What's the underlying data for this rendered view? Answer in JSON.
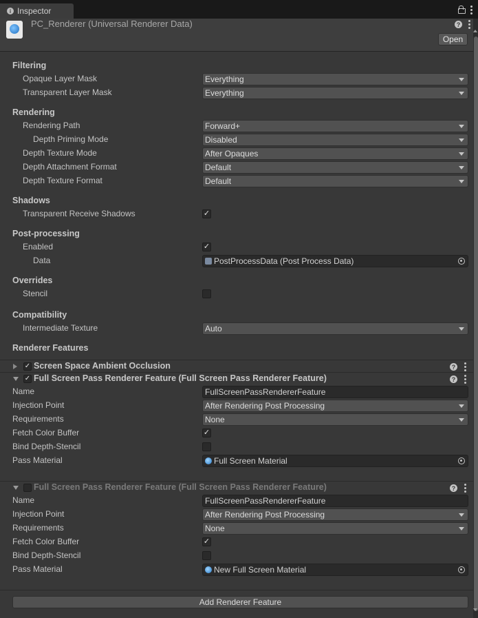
{
  "tab": {
    "label": "Inspector"
  },
  "header": {
    "title": "PC_Renderer (Universal Renderer Data)",
    "open_label": "Open"
  },
  "sections": {
    "filtering": "Filtering",
    "rendering": "Rendering",
    "shadows": "Shadows",
    "postprocessing": "Post-processing",
    "overrides": "Overrides",
    "compatibility": "Compatibility",
    "renderer_features": "Renderer Features"
  },
  "fields": {
    "opaque_layer_mask": {
      "label": "Opaque Layer Mask",
      "value": "Everything"
    },
    "transparent_layer_mask": {
      "label": "Transparent Layer Mask",
      "value": "Everything"
    },
    "rendering_path": {
      "label": "Rendering Path",
      "value": "Forward+"
    },
    "depth_priming_mode": {
      "label": "Depth Priming Mode",
      "value": "Disabled"
    },
    "depth_texture_mode": {
      "label": "Depth Texture Mode",
      "value": "After Opaques"
    },
    "depth_attachment_format": {
      "label": "Depth Attachment Format",
      "value": "Default"
    },
    "depth_texture_format": {
      "label": "Depth Texture Format",
      "value": "Default"
    },
    "transparent_receive_shadows": {
      "label": "Transparent Receive Shadows",
      "checked": true
    },
    "pp_enabled": {
      "label": "Enabled",
      "checked": true
    },
    "pp_data": {
      "label": "Data",
      "value": "PostProcessData (Post Process Data)"
    },
    "stencil": {
      "label": "Stencil",
      "checked": false
    },
    "intermediate_texture": {
      "label": "Intermediate Texture",
      "value": "Auto"
    }
  },
  "features": [
    {
      "title": "Screen Space Ambient Occlusion",
      "enabled": true,
      "expanded": false
    },
    {
      "title": "Full Screen Pass Renderer Feature (Full Screen Pass Renderer Feature)",
      "enabled": true,
      "expanded": true,
      "name_label": "Name",
      "name_value": "FullScreenPassRendererFeature",
      "injection_label": "Injection Point",
      "injection_value": "After Rendering Post Processing",
      "requirements_label": "Requirements",
      "requirements_value": "None",
      "fetch_label": "Fetch Color Buffer",
      "fetch_checked": true,
      "bind_label": "Bind Depth-Stencil",
      "bind_checked": false,
      "material_label": "Pass Material",
      "material_value": "Full Screen Material"
    },
    {
      "title": "Full Screen Pass Renderer Feature (Full Screen Pass Renderer Feature)",
      "enabled": false,
      "expanded": true,
      "name_label": "Name",
      "name_value": "FullScreenPassRendererFeature",
      "injection_label": "Injection Point",
      "injection_value": "After Rendering Post Processing",
      "requirements_label": "Requirements",
      "requirements_value": "None",
      "fetch_label": "Fetch Color Buffer",
      "fetch_checked": true,
      "bind_label": "Bind Depth-Stencil",
      "bind_checked": false,
      "material_label": "Pass Material",
      "material_value": "New Full Screen Material"
    }
  ],
  "add_feature_label": "Add Renderer Feature",
  "glyphs": {
    "check": "✓",
    "help": "?",
    "info": "i"
  },
  "icons": [
    "info-icon",
    "lock-icon",
    "kebab-menu-icon",
    "help-icon",
    "object-picker-icon",
    "material-icon",
    "asset-icon"
  ],
  "colors": {
    "background": "#383838",
    "field": "#515151",
    "text": "#c4c4c4"
  }
}
